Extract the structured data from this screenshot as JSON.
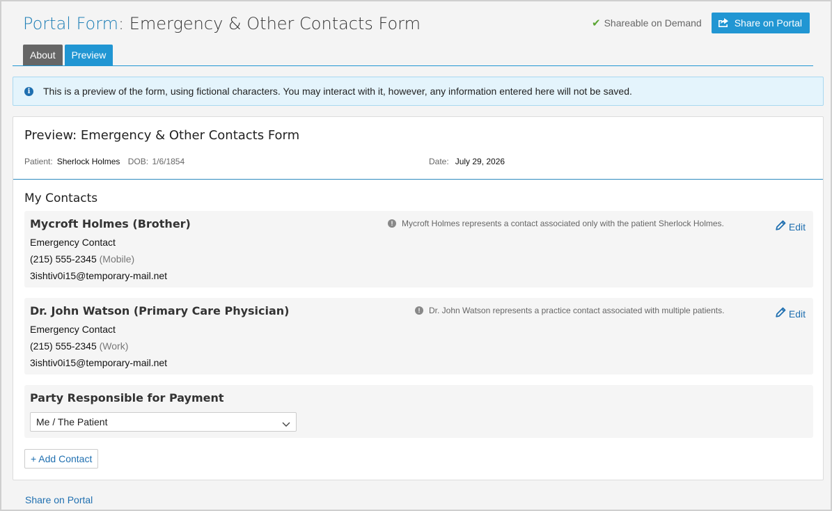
{
  "header": {
    "title_brand": "Portal Form",
    "title_rest": ": Emergency & Other Contacts Form",
    "shareable_label": "Shareable on Demand",
    "share_button": "Share on Portal"
  },
  "tabs": [
    {
      "label": "About",
      "active": false
    },
    {
      "label": "Preview",
      "active": true
    }
  ],
  "info_banner": "This is a preview of the form, using fictional characters. You may interact with it, however, any information entered here will not be saved.",
  "preview": {
    "title": "Preview: Emergency & Other Contacts Form",
    "patient_label": "Patient:",
    "patient_name": "Sherlock Holmes",
    "dob_label": "DOB:",
    "dob_value": "1/6/1854",
    "date_label": "Date:",
    "date_value": "July 29, 2026"
  },
  "contacts_section": {
    "title": "My Contacts",
    "contacts": [
      {
        "name": "Mycroft Holmes (Brother)",
        "type": "Emergency Contact",
        "phone": "(215) 555-2345",
        "phone_type": "(Mobile)",
        "email": "3ishtiv0i15@temporary-mail.net",
        "note": "Mycroft Holmes represents a contact associated only with the patient Sherlock Holmes.",
        "edit_label": "Edit"
      },
      {
        "name": "Dr. John Watson (Primary Care Physician)",
        "type": "Emergency Contact",
        "phone": "(215) 555-2345",
        "phone_type": "(Work)",
        "email": "3ishtiv0i15@temporary-mail.net",
        "note": "Dr. John Watson represents a practice contact associated with multiple patients.",
        "edit_label": "Edit"
      }
    ],
    "payment": {
      "label": "Party Responsible for Payment",
      "selected": "Me / The Patient"
    },
    "add_contact_button": "+ Add Contact"
  },
  "footer": {
    "share_link": "Share on Portal"
  },
  "colors": {
    "accent": "#2196d3",
    "link": "#1f6fb0",
    "tab_inactive": "#666666",
    "check_green": "#5aa532"
  },
  "icons": {
    "check": "check-icon",
    "share": "share-icon",
    "info": "info-icon",
    "warning": "exclamation-circle-icon",
    "edit": "pencil-icon",
    "dropdown": "chevron-down-icon"
  }
}
